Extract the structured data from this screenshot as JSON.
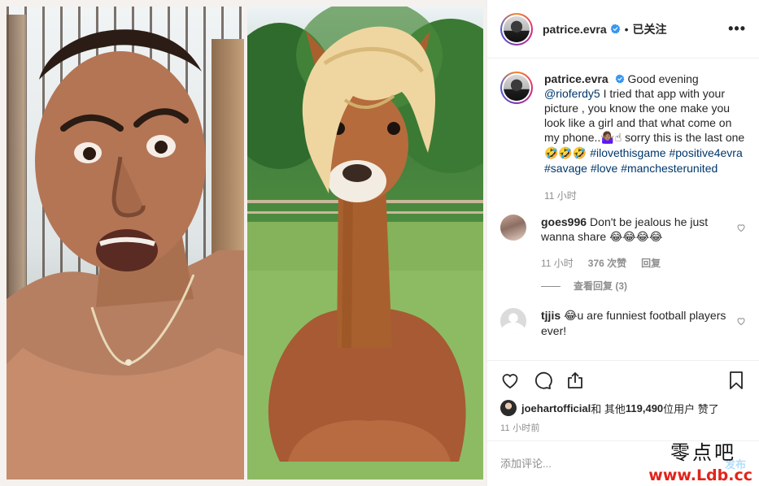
{
  "post": {
    "username": "patrice.evra",
    "follow_status": "已关注",
    "dot": "•",
    "more": "•••"
  },
  "caption": {
    "username": "patrice.evra",
    "text_parts": {
      "p1": "Good evening ",
      "mention": "@rioferdy5",
      "p2": " I tried that app with your picture , you know the one make you look like a girl and that what come on my phone..",
      "e1": "🤷🏽‍♀️☝",
      "p3": " sorry this is the last one ",
      "e2": "🤣🤣🤣",
      "sp1": " ",
      "h1": "#ilovethisgame",
      "sp2": " ",
      "h2": "#positive4evra",
      "sp3": " ",
      "h3": "#savage",
      "sp4": " ",
      "h4": "#love",
      "sp5": " ",
      "h5": "#manchesterunited"
    },
    "time": "11 小时"
  },
  "comments": [
    {
      "username": "goes996",
      "text": "Don't be jealous he just wanna share ",
      "emoji": "😂😂😂😂",
      "time": "11 小时",
      "likes": "376 次赞",
      "reply": "回复",
      "view_replies": "查看回复 (3)"
    },
    {
      "username": "tjjis",
      "emoji": "😂",
      "text": "u are funniest football players ever!"
    }
  ],
  "likes": {
    "user": "joehartofficial",
    "and": " 和 其他 ",
    "count": "119,490",
    "suffix": " 位用户 赞了"
  },
  "timestamp": "11 小时前",
  "add_comment": {
    "placeholder": "添加评论...",
    "post_label": "发布"
  },
  "watermark": {
    "cn": "零点吧",
    "url": "www.Ldb.cc"
  },
  "icons": [
    "verified-icon",
    "heart-icon",
    "comment-icon",
    "share-icon",
    "bookmark-icon",
    "more-icon"
  ],
  "colors": {
    "link": "#00376b",
    "verified": "#3897f0",
    "muted": "#8e8e8e",
    "post_button": "#0095f6"
  }
}
